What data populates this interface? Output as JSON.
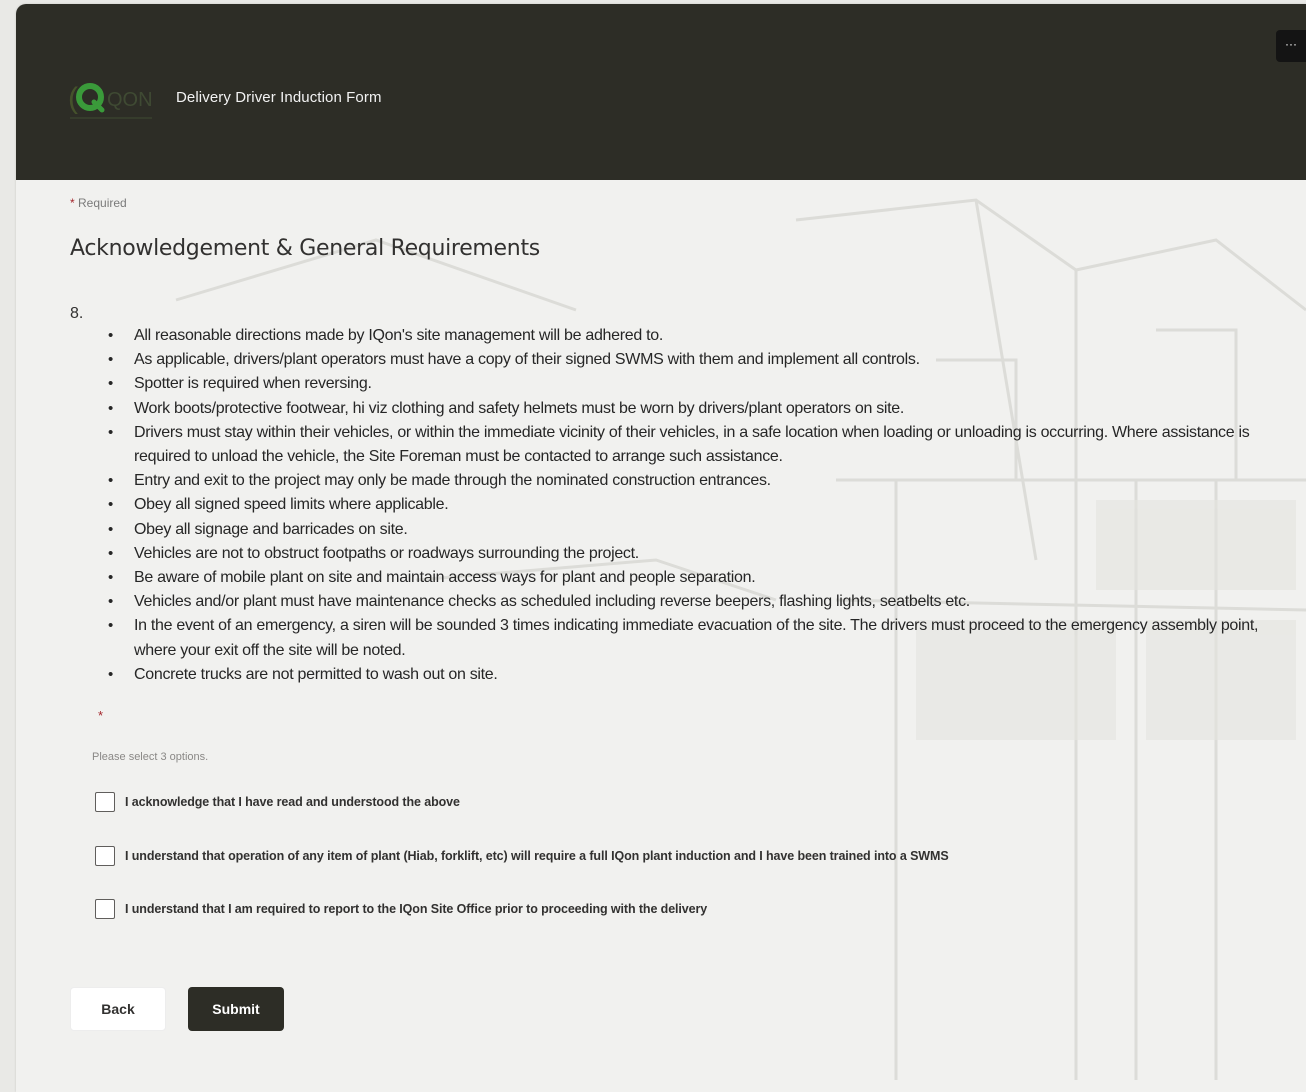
{
  "header": {
    "logo_text": "QON",
    "form_title": "Delivery Driver Induction Form",
    "more_label": "···"
  },
  "form": {
    "required_star": "*",
    "required_label": "Required",
    "section_title": "Acknowledgement & General Requirements",
    "question_number": "8.",
    "bullets": [
      "All reasonable directions made by IQon's site management will be adhered to.",
      "As applicable, drivers/plant operators must have a copy of their signed SWMS with them and implement all controls.",
      "Spotter is required when reversing.",
      "Work boots/protective footwear, hi viz clothing and safety helmets must be worn by drivers/plant operators on site.",
      "Drivers must stay within their vehicles, or within the immediate vicinity of their vehicles, in a safe location when loading or unloading is occurring. Where assistance is required to unload the vehicle, the Site Foreman must be contacted to arrange such assistance.",
      "Entry and exit to the project may only be made through the nominated construction entrances.",
      "Obey all signed speed limits where applicable.",
      "Obey all signage and barricades on site.",
      "Vehicles are not to obstruct footpaths or roadways surrounding the project.",
      "Be aware of mobile plant on site and maintain access ways for plant and people separation.",
      "Vehicles and/or plant must have maintenance checks as scheduled including reverse beepers, flashing lights, seatbelts etc.",
      "In the event of an emergency, a siren will be sounded 3 times indicating immediate evacuation of the site. The drivers must proceed to the emergency assembly point, where your exit off the site will be noted.",
      "Concrete trucks are not permitted to wash out on site."
    ],
    "answer_required_star": "*",
    "hint": "Please select 3 options.",
    "options": [
      {
        "label": "I acknowledge that I have read and understood the above",
        "checked": false
      },
      {
        "label": "I understand that operation of any item of plant (Hiab, forklift, etc) will require a full IQon plant induction and I have been trained into a SWMS",
        "checked": false
      },
      {
        "label": "I understand that I am required to report to the IQon Site Office prior to proceeding with the delivery",
        "checked": false
      }
    ]
  },
  "actions": {
    "back_label": "Back",
    "submit_label": "Submit"
  },
  "colors": {
    "header_bg": "#2d2d26",
    "logo_green": "#3a9a3a",
    "required_red": "#a4262c",
    "page_bg": "#f1f1ef"
  }
}
